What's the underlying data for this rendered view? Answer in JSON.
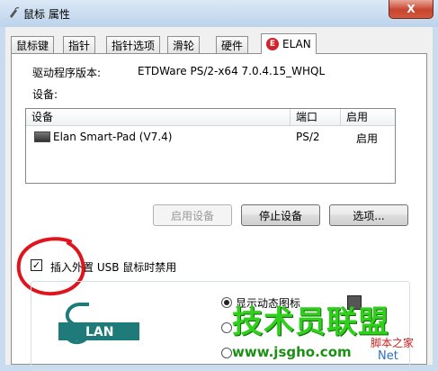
{
  "window": {
    "title": "鼠标 属性",
    "close_label": "X"
  },
  "tabs": [
    {
      "label": "鼠标键"
    },
    {
      "label": "指针"
    },
    {
      "label": "指针选项"
    },
    {
      "label": "滑轮"
    },
    {
      "label": "硬件"
    },
    {
      "label": "ELAN",
      "logo_text": "E",
      "active": true
    }
  ],
  "driver": {
    "label": "驱动程序版本:",
    "value": "ETDWare PS/2-x64 7.0.4.15_WHQL"
  },
  "devices_label": "设备:",
  "device_list": {
    "columns": [
      "设备",
      "端口",
      "启用"
    ],
    "rows": [
      {
        "device": "Elan Smart-Pad  (V7.4)",
        "port": "PS/2",
        "enabled": "启用",
        "icon": "touchpad-icon"
      }
    ]
  },
  "buttons": {
    "enable": "启用设备",
    "stop": "停止设备",
    "options": "选项..."
  },
  "disable_usb": {
    "checked": true,
    "check_mark": "✓",
    "label": "插入外置 USB 鼠标时禁用"
  },
  "options_group": {
    "logo_text": "LAN",
    "radio_1_label": "显示动态图标"
  },
  "watermark": {
    "big": "技术员联盟",
    "url": "www.jsgho.com",
    "small": "脚本之家",
    "net": "Net"
  },
  "colors": {
    "annotation_circle": "#e0141d",
    "watermark_green": "#2fcf1c",
    "elan_red": "#d4232b",
    "elan_teal": "#1f7a7a"
  }
}
